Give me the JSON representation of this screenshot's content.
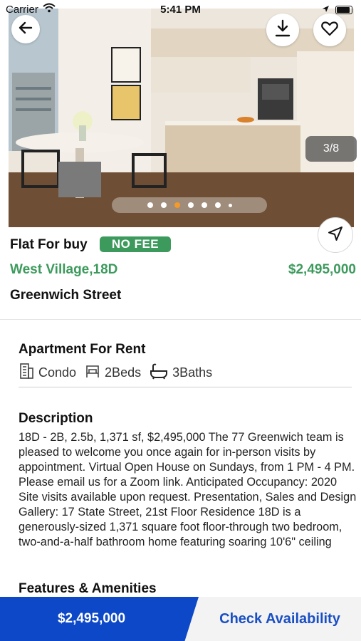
{
  "status_bar": {
    "carrier": "Carrier",
    "time": "5:41 PM"
  },
  "gallery": {
    "counter": "3/8",
    "dots": 7,
    "active_dot": 2
  },
  "listing": {
    "type": "Flat For buy",
    "badge": "NO FEE",
    "location": "West Village,18D",
    "price": "$2,495,000",
    "street": "Greenwich Street"
  },
  "property": {
    "title": "Apartment For Rent",
    "features": [
      {
        "icon": "building-icon",
        "label": "Condo"
      },
      {
        "icon": "bed-icon",
        "label": "2Beds"
      },
      {
        "icon": "bathtub-icon",
        "label": "3Baths"
      }
    ]
  },
  "description": {
    "title": "Description",
    "body": "18D - 2B, 2.5b, 1,371 sf, $2,495,000 The 77 Greenwich team is pleased to welcome you once again for in-person visits by appointment. Virtual Open House on Sundays, from 1 PM - 4 PM. Please email us for a Zoom link. Anticipated Occupancy: 2020 Site visits available upon request. Presentation, Sales and Design Gallery: 17 State Street, 21st Floor Residence 18D is a generously-sized 1,371 square foot floor-through two bedroom, two-and-a-half bathroom home featuring soaring 10'6\" ceiling"
  },
  "amenities": {
    "title": "Features & Amenities"
  },
  "bottom_bar": {
    "price_label": "$2,495,000",
    "availability_label": "Check Availability"
  },
  "colors": {
    "accent_green": "#3d9a5d",
    "primary_blue": "#0c48c7",
    "dot_active": "#f39a2b"
  }
}
